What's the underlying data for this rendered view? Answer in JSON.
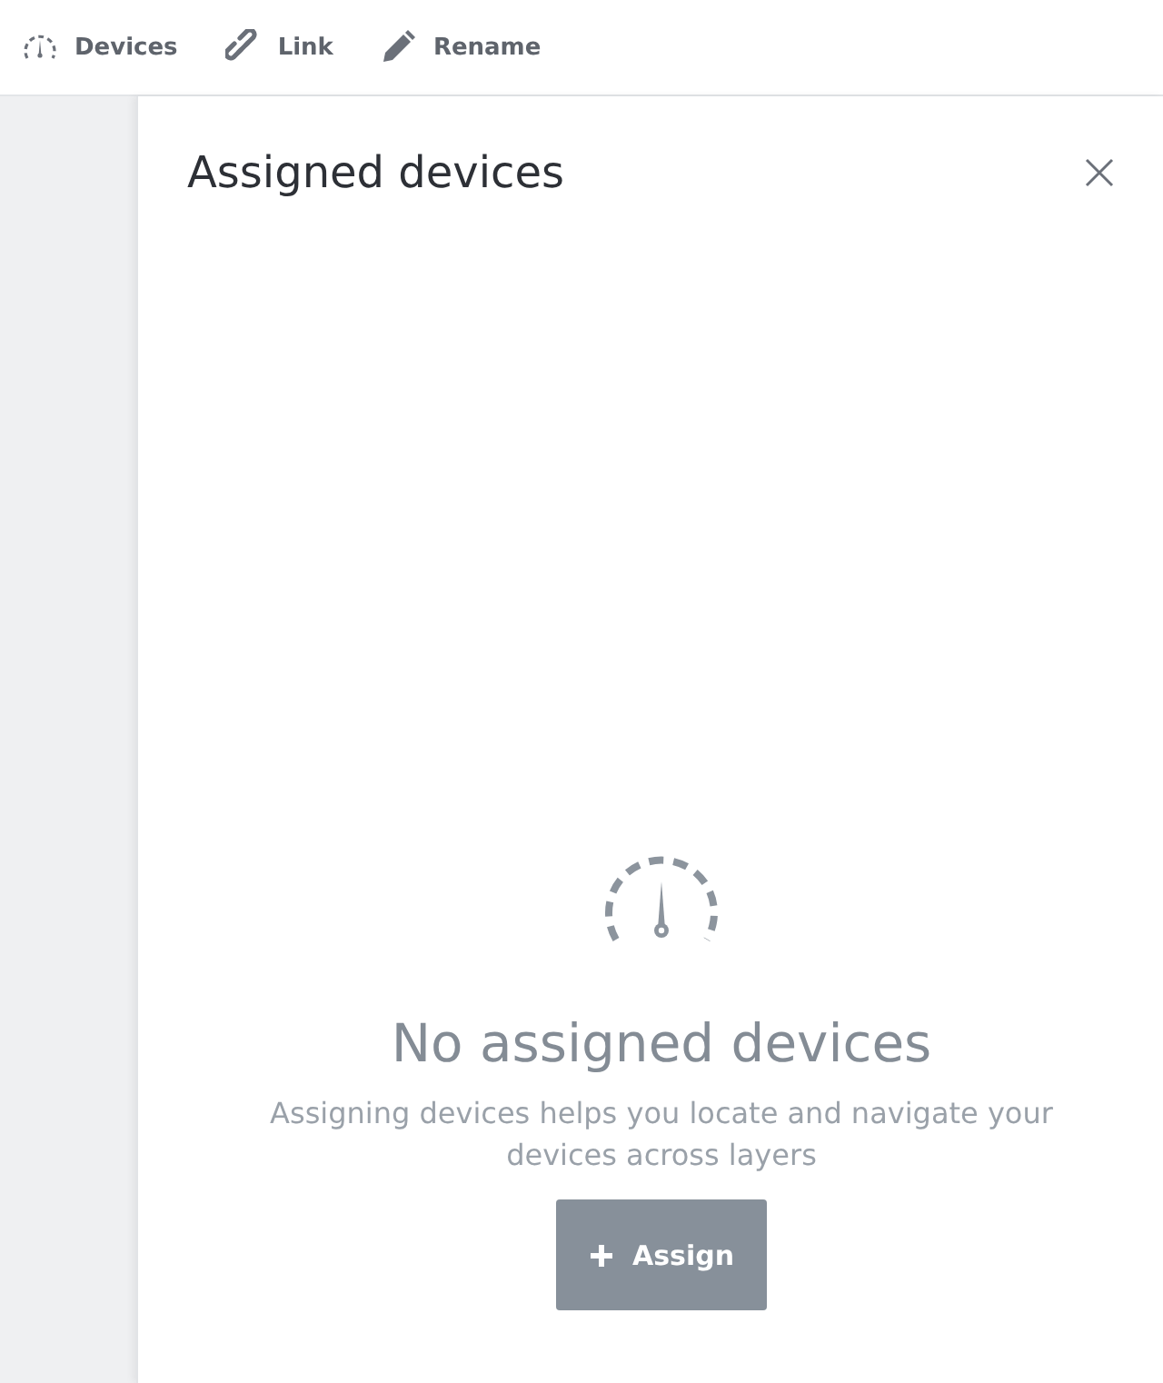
{
  "toolbar": [
    {
      "label": "Devices"
    },
    {
      "label": "Link"
    },
    {
      "label": "Rename"
    }
  ],
  "panel": {
    "title": "Assigned devices",
    "empty_state": {
      "heading": "No assigned devices",
      "description": "Assigning devices helps you locate and navigate your devices across layers",
      "button": "Assign"
    }
  }
}
